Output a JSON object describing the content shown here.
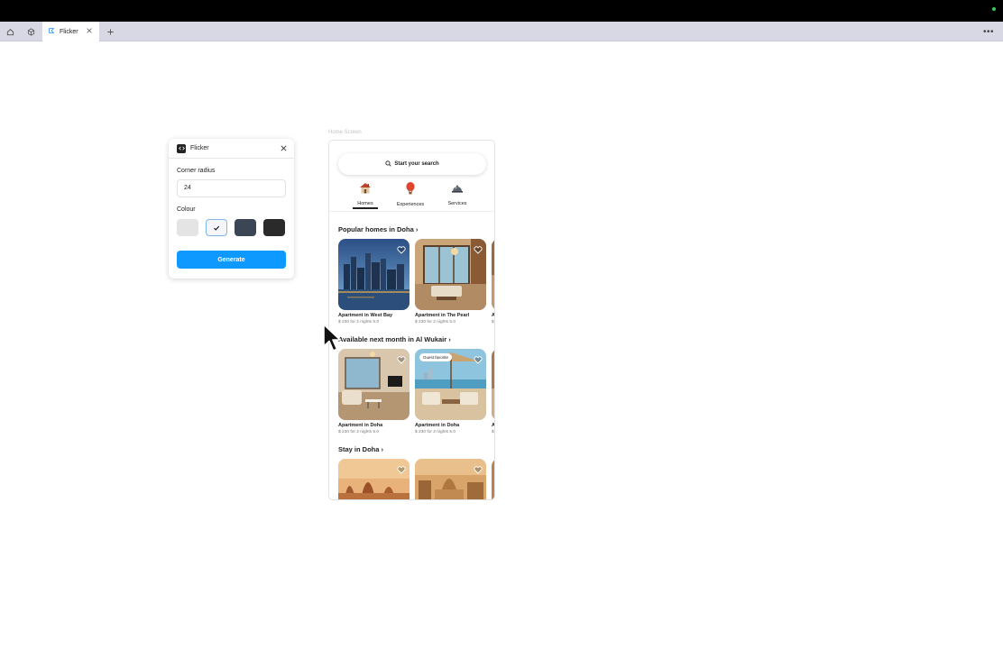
{
  "browser": {
    "tab_title": "Flicker"
  },
  "plugin": {
    "title": "Flicker",
    "corner_radius_label": "Corner radius",
    "corner_radius_value": "24",
    "colour_label": "Colour",
    "swatches": [
      "#e4e4e4",
      "#f4f6fa",
      "#3c4553",
      "#2a2a2a"
    ],
    "selected_swatch": 2,
    "generate_label": "Generate"
  },
  "frame": {
    "label": "Home Screen",
    "search_placeholder": "Start your search",
    "categories": [
      {
        "label": "Homes",
        "icon": "house-icon",
        "active": true
      },
      {
        "label": "Experiences",
        "icon": "hot-air-balloon-icon",
        "active": false
      },
      {
        "label": "Services",
        "icon": "service-bell-icon",
        "active": false
      }
    ],
    "sections": [
      {
        "title": "Popular homes in Doha",
        "cards": [
          {
            "title": "Apartment in West Bay",
            "sub": "$ 230 for 2 nights 5.0",
            "badge": ""
          },
          {
            "title": "Apartment in The Pearl",
            "sub": "$ 230 for 2 nights 5.0",
            "badge": ""
          },
          {
            "title": "A",
            "sub": "$",
            "badge": ""
          }
        ]
      },
      {
        "title": "Available next month in Al Wukair",
        "cards": [
          {
            "title": "Apartment in Doha",
            "sub": "$ 230 for 2 nights 5.0",
            "badge": ""
          },
          {
            "title": "Apartment in Doha",
            "sub": "$ 230 for 2 nights 5.0",
            "badge": "Guest favorite"
          },
          {
            "title": "A",
            "sub": "$",
            "badge": ""
          }
        ]
      },
      {
        "title": "Stay in Doha",
        "cards": [
          {
            "title": "",
            "sub": "",
            "badge": ""
          },
          {
            "title": "",
            "sub": "",
            "badge": ""
          },
          {
            "title": "",
            "sub": "",
            "badge": ""
          }
        ]
      }
    ]
  },
  "colors": {
    "accent": "#0d99ff",
    "tab_bar": "#d8d8e4"
  }
}
